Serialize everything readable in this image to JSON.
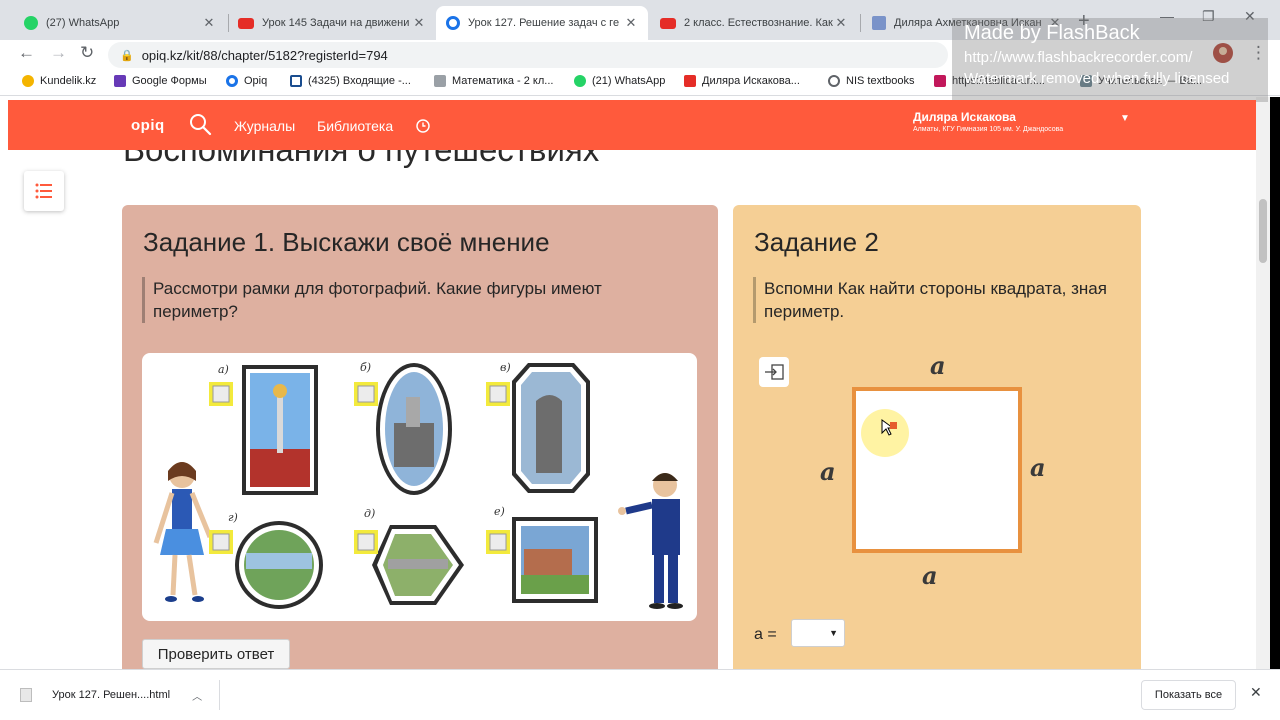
{
  "browser": {
    "tabs": [
      {
        "title": "(27) WhatsApp",
        "icon": "whatsapp-icon"
      },
      {
        "title": "Урок 145 Задачи на движени",
        "icon": "youtube-icon"
      },
      {
        "title": "Урок 127. Решение задач с ге",
        "icon": "opiq-icon"
      },
      {
        "title": "2 класс. Естествознание. Как",
        "icon": "youtube-icon"
      },
      {
        "title": "Диляра Ахметкановна Искан",
        "icon": "document-icon"
      }
    ],
    "address": "opiq.kz/kit/88/chapter/5182?registerId=794",
    "bookmarks": [
      "Kundelik.kz",
      "Google Формы",
      "Opiq",
      "(4325) Входящие -...",
      "Математика - 2 кл...",
      "(21) WhatsApp",
      "Диляра Искакова...",
      "NIS textbooks",
      "https://tablica-um...",
      "Учительская — Ва..."
    ]
  },
  "watermark": {
    "title": "Made by FlashBack",
    "url": "http://www.flashbackrecorder.com/",
    "note": "Watermark removed when fully licensed"
  },
  "site": {
    "logo": "opiq",
    "nav": [
      "Журналы",
      "Библиотека"
    ],
    "user_name": "Диляра Искакова",
    "user_school": "Алматы, КГУ Гимназия 105 им. У. Джандосова"
  },
  "page": {
    "heading": "Воспоминания о путешествиях"
  },
  "task1": {
    "title": "Задание 1. Выскажи своё мнение",
    "prompt": "Рассмотри рамки для фотографий. Какие фигуры имеют периметр?",
    "frame_labels": [
      "а)",
      "б)",
      "в)",
      "г)",
      "д)",
      "е)"
    ],
    "check_button": "Проверить ответ"
  },
  "task2": {
    "title": "Задание 2",
    "prompt": "Вспомни Как найти стороны квадрата, зная периметр.",
    "side_label": "a",
    "answer_label": "a ="
  },
  "downloads": {
    "file": "Урок 127. Решен....html",
    "show_all": "Показать все"
  },
  "colors": {
    "brand": "#ff5a3c",
    "task1_bg": "#deb0a0",
    "task2_bg": "#f5cf95",
    "square_border": "#e8913f"
  }
}
